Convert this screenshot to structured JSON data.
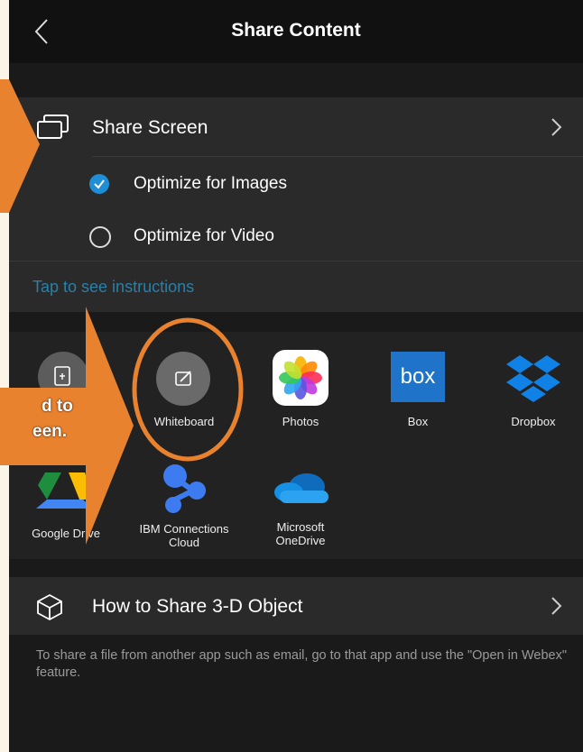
{
  "header": {
    "title": "Share Content",
    "back_icon": "chevron-left-icon"
  },
  "share_screen": {
    "label": "Share Screen",
    "options": [
      {
        "label": "Optimize for Images",
        "checked": true
      },
      {
        "label": "Optimize for Video",
        "checked": false
      }
    ],
    "instructions_link": "Tap to see instructions"
  },
  "apps": [
    {
      "label": "Whiteboard",
      "icon": "pencil-icon"
    },
    {
      "label": "Photos",
      "icon": "photos-icon"
    },
    {
      "label": "Box",
      "icon": "box-icon",
      "icon_text": "box"
    },
    {
      "label": "Dropbox",
      "icon": "dropbox-icon"
    },
    {
      "label": "Google Drive",
      "icon": "google-drive-icon"
    },
    {
      "label": "IBM Connections Cloud",
      "icon": "ibm-connections-icon"
    },
    {
      "label": "Microsoft OneDrive",
      "icon": "onedrive-icon"
    }
  ],
  "three_d": {
    "label": "How to Share 3-D Object",
    "info": "To share a file from another app such as email, go to that app and use the \"Open in Webex\" feature."
  },
  "annotation": {
    "line1": "d to",
    "line2": "een.",
    "accent": "#e8822f"
  },
  "colors": {
    "link": "#2a7fa8",
    "checkbox": "#1e8ed6",
    "accent": "#e8822f"
  }
}
